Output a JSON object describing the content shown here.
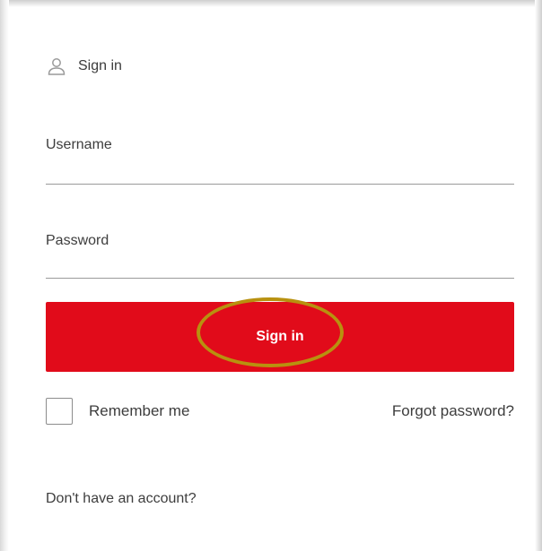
{
  "header": {
    "icon": "user-icon",
    "title": "Sign in"
  },
  "form": {
    "username_label": "Username",
    "password_label": "Password",
    "submit_label": "Sign in",
    "remember_label": "Remember me",
    "remember_checked": false,
    "forgot_label": "Forgot password?",
    "no_account_label": "Don't have an account?"
  },
  "colors": {
    "primary": "#e10b1a",
    "highlight": "#b8910f",
    "text": "#3d3d3d",
    "underline": "#9a9a9a"
  }
}
